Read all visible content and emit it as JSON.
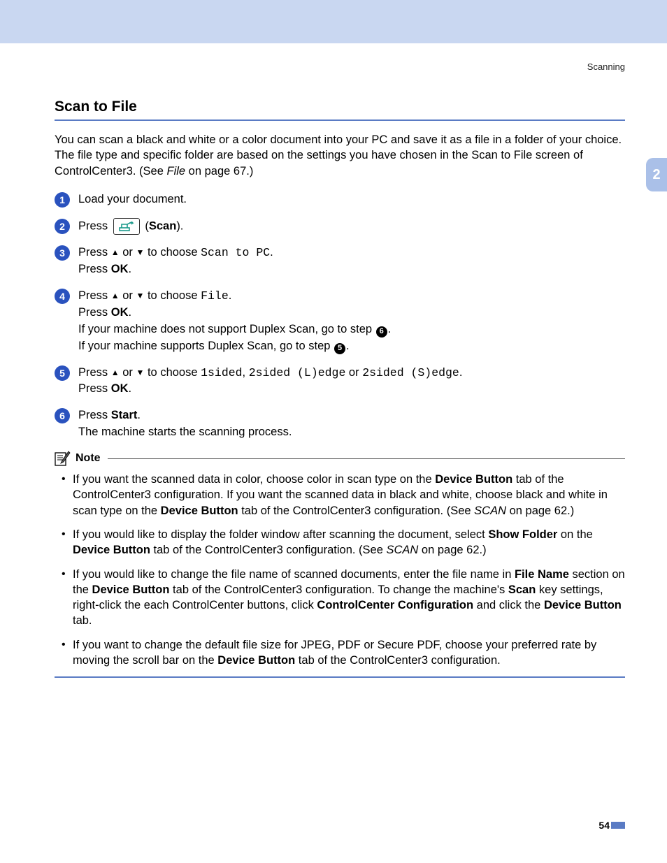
{
  "header": {
    "running_title": "Scanning"
  },
  "chapter_tab": "2",
  "section_title": "Scan to File",
  "intro": {
    "text_a": "You can scan a black and white or a color document into your PC and save it as a file in a folder of your choice. The file type and specific folder are based on the settings you have chosen in the Scan to File screen of ControlCenter3. (See ",
    "link_label": "File",
    "text_b": " on page 67.)"
  },
  "steps": {
    "s1": {
      "num": "1",
      "text": "Load your document."
    },
    "s2": {
      "num": "2",
      "press": "Press",
      "label": "Scan"
    },
    "s3": {
      "num": "3",
      "line1_a": "Press ",
      "line1_b": " or ",
      "line1_c": " to choose ",
      "mono": "Scan to PC",
      "line2_a": "Press ",
      "ok": "OK"
    },
    "s4": {
      "num": "4",
      "line1_a": "Press ",
      "line1_b": " or ",
      "line1_c": " to choose ",
      "mono": "File",
      "line2_a": "Press ",
      "ok": "OK",
      "line3_a": "If your machine does not support Duplex Scan, go to step ",
      "ref3": "6",
      "line4_a": "If your machine supports Duplex Scan, go to step ",
      "ref4": "5"
    },
    "s5": {
      "num": "5",
      "line1_a": "Press ",
      "line1_b": " or ",
      "line1_c": " to choose ",
      "mono1": "1sided",
      "sep1": ", ",
      "mono2": "2sided (L)edge",
      "or": " or ",
      "mono3": "2sided (S)edge",
      "line2_a": "Press ",
      "ok": "OK"
    },
    "s6": {
      "num": "6",
      "line1_a": "Press ",
      "start": "Start",
      "line2": "The machine starts the scanning process."
    }
  },
  "note": {
    "label": "Note",
    "n1": {
      "a": "If you want the scanned data in color, choose color in scan type on the ",
      "b1": "Device Button",
      "c": " tab of the ControlCenter3 configuration. If you want the scanned data in black and white, choose black and white in scan type on the ",
      "b2": "Device Button",
      "d": " tab of the ControlCenter3 configuration. (See ",
      "link": "SCAN",
      "e": " on page 62.)"
    },
    "n2": {
      "a": "If you would like to display the folder window after scanning the document, select ",
      "b1": "Show Folder",
      "c": " on the ",
      "b2": "Device Button",
      "d": " tab of the ControlCenter3 configuration. (See ",
      "link": "SCAN",
      "e": " on page 62.)"
    },
    "n3": {
      "a": "If you would like to change the file name of scanned documents, enter the file name in ",
      "b1": "File Name",
      "c": " section on the ",
      "b2": "Device Button",
      "d": " tab of the ControlCenter3 configuration. To change the machine's ",
      "b3": "Scan",
      "e": " key settings, right-click the each ControlCenter buttons, click ",
      "b4": "ControlCenter Configuration",
      "f": " and click the ",
      "b5": "Device Button",
      "g": " tab."
    },
    "n4": {
      "a": "If you want to change the default file size for JPEG, PDF or Secure PDF, choose your preferred rate by moving the scroll bar on the ",
      "b1": "Device Button",
      "c": " tab of the ControlCenter3 configuration."
    }
  },
  "page_number": "54"
}
